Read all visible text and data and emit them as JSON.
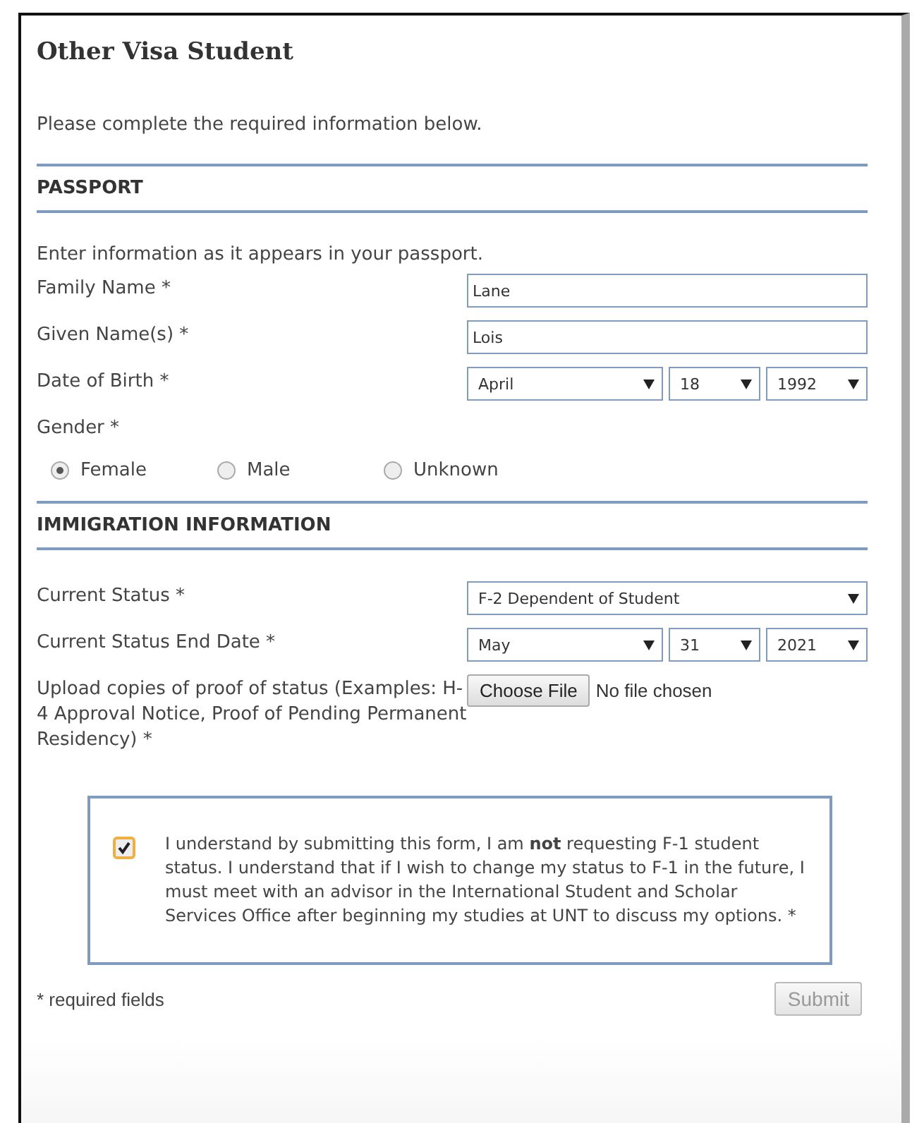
{
  "title": "Other Visa Student",
  "intro": "Please complete the required information below.",
  "sections": [
    {
      "heading": "PASSPORT",
      "note": "Enter information as it appears in your passport.",
      "fields": [
        {
          "kind": "text",
          "label": "Family Name *",
          "value": "Lane"
        },
        {
          "kind": "text",
          "label": "Given Name(s) *",
          "value": "Lois"
        },
        {
          "kind": "date",
          "label": "Date of Birth *",
          "month": "April",
          "day": "18",
          "year": "1992"
        },
        {
          "kind": "radio",
          "label": "Gender *",
          "options": [
            {
              "label": "Female",
              "selected": true
            },
            {
              "label": "Male",
              "selected": false
            },
            {
              "label": "Unknown",
              "selected": false
            }
          ]
        }
      ]
    },
    {
      "heading": "IMMIGRATION INFORMATION",
      "fields": [
        {
          "kind": "select",
          "label": "Current Status *",
          "value": "F-2 Dependent of Student"
        },
        {
          "kind": "date",
          "label": "Current Status End Date *",
          "month": "May",
          "day": "31",
          "year": "2021"
        },
        {
          "kind": "file",
          "label": "Upload copies of proof of status (Examples: H-4 Approval Notice, Proof of Pending Permanent Residency) *",
          "button": "Choose File",
          "status": "No file chosen"
        }
      ]
    }
  ],
  "agreement": {
    "checked": true,
    "text": "I understand by submitting this form, I am **not** requesting F-1 student status. I understand that if I wish to change my status to F-1 in the future, I must meet with an advisor in the International Student and Scholar Services Office after beginning my studies at UNT to discuss my options.  *"
  },
  "footnote": "* required fields",
  "submit": "Submit"
}
